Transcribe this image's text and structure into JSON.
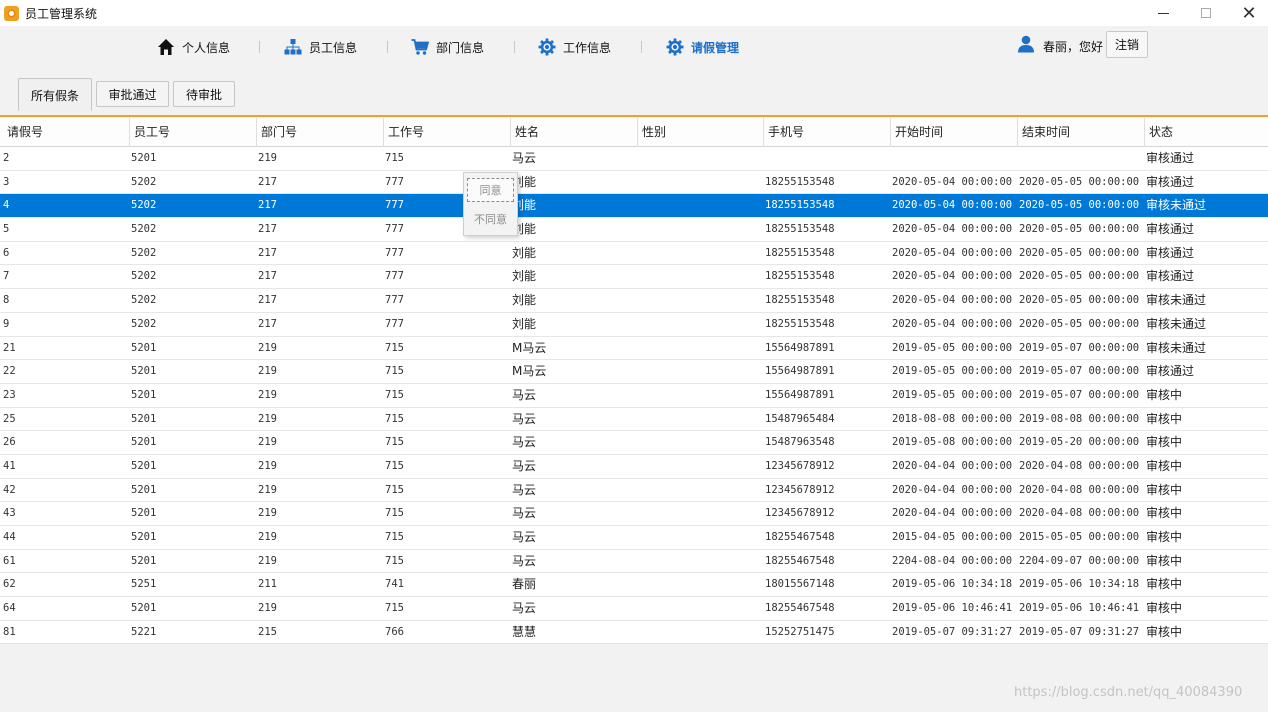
{
  "window": {
    "title": "员工管理系统",
    "minimize": "—",
    "close": "✕"
  },
  "nav": {
    "items": [
      {
        "label": "个人信息",
        "icon": "home-icon"
      },
      {
        "label": "员工信息",
        "icon": "org-tree-icon"
      },
      {
        "label": "部门信息",
        "icon": "cart-icon"
      },
      {
        "label": "工作信息",
        "icon": "gear-icon"
      },
      {
        "label": "请假管理",
        "icon": "gear-icon",
        "active": true
      }
    ],
    "greeting": "春丽，您好",
    "logout_label": "注销"
  },
  "tabs": [
    {
      "label": "所有假条",
      "selected": true
    },
    {
      "label": "审批通过"
    },
    {
      "label": "待审批"
    }
  ],
  "table": {
    "columns": [
      "请假号",
      "员工号",
      "部门号",
      "工作号",
      "姓名",
      "性别",
      "手机号",
      "开始时间",
      "结束时间",
      "状态"
    ],
    "selected_row": 2,
    "rows": [
      [
        "2",
        "5201",
        "219",
        "715",
        "马云",
        "",
        "",
        "",
        "",
        "审核通过"
      ],
      [
        "3",
        "5202",
        "217",
        "777",
        "刘能",
        "",
        "18255153548",
        "2020-05-04 00:00:00",
        "2020-05-05 00:00:00",
        "审核通过"
      ],
      [
        "4",
        "5202",
        "217",
        "777",
        "刘能",
        "",
        "18255153548",
        "2020-05-04 00:00:00",
        "2020-05-05 00:00:00",
        "审核未通过"
      ],
      [
        "5",
        "5202",
        "217",
        "777",
        "刘能",
        "",
        "18255153548",
        "2020-05-04 00:00:00",
        "2020-05-05 00:00:00",
        "审核通过"
      ],
      [
        "6",
        "5202",
        "217",
        "777",
        "刘能",
        "",
        "18255153548",
        "2020-05-04 00:00:00",
        "2020-05-05 00:00:00",
        "审核通过"
      ],
      [
        "7",
        "5202",
        "217",
        "777",
        "刘能",
        "",
        "18255153548",
        "2020-05-04 00:00:00",
        "2020-05-05 00:00:00",
        "审核通过"
      ],
      [
        "8",
        "5202",
        "217",
        "777",
        "刘能",
        "",
        "18255153548",
        "2020-05-04 00:00:00",
        "2020-05-05 00:00:00",
        "审核未通过"
      ],
      [
        "9",
        "5202",
        "217",
        "777",
        "刘能",
        "",
        "18255153548",
        "2020-05-04 00:00:00",
        "2020-05-05 00:00:00",
        "审核未通过"
      ],
      [
        "21",
        "5201",
        "219",
        "715",
        "M马云",
        "",
        "15564987891",
        "2019-05-05 00:00:00",
        "2019-05-07 00:00:00",
        "审核未通过"
      ],
      [
        "22",
        "5201",
        "219",
        "715",
        "M马云",
        "",
        "15564987891",
        "2019-05-05 00:00:00",
        "2019-05-07 00:00:00",
        "审核通过"
      ],
      [
        "23",
        "5201",
        "219",
        "715",
        "马云",
        "",
        "15564987891",
        "2019-05-05 00:00:00",
        "2019-05-07 00:00:00",
        "审核中"
      ],
      [
        "25",
        "5201",
        "219",
        "715",
        "马云",
        "",
        "15487965484",
        "2018-08-08 00:00:00",
        "2019-08-08 00:00:00",
        "审核中"
      ],
      [
        "26",
        "5201",
        "219",
        "715",
        "马云",
        "",
        "15487963548",
        "2019-05-08 00:00:00",
        "2019-05-20 00:00:00",
        "审核中"
      ],
      [
        "41",
        "5201",
        "219",
        "715",
        "马云",
        "",
        "12345678912",
        "2020-04-04 00:00:00",
        "2020-04-08 00:00:00",
        "审核中"
      ],
      [
        "42",
        "5201",
        "219",
        "715",
        "马云",
        "",
        "12345678912",
        "2020-04-04 00:00:00",
        "2020-04-08 00:00:00",
        "审核中"
      ],
      [
        "43",
        "5201",
        "219",
        "715",
        "马云",
        "",
        "12345678912",
        "2020-04-04 00:00:00",
        "2020-04-08 00:00:00",
        "审核中"
      ],
      [
        "44",
        "5201",
        "219",
        "715",
        "马云",
        "",
        "18255467548",
        "2015-04-05 00:00:00",
        "2015-05-05 00:00:00",
        "审核中"
      ],
      [
        "61",
        "5201",
        "219",
        "715",
        "马云",
        "",
        "18255467548",
        "2204-08-04 00:00:00",
        "2204-09-07 00:00:00",
        "审核中"
      ],
      [
        "62",
        "5251",
        "211",
        "741",
        "春丽",
        "",
        "18015567148",
        "2019-05-06 10:34:18",
        "2019-05-06 10:34:18",
        "审核中"
      ],
      [
        "64",
        "5201",
        "219",
        "715",
        "马云",
        "",
        "18255467548",
        "2019-05-06 10:46:41",
        "2019-05-06 10:46:41",
        "审核中"
      ],
      [
        "81",
        "5221",
        "215",
        "766",
        "慧慧",
        "",
        "15252751475",
        "2019-05-07 09:31:27",
        "2019-05-07 09:31:27",
        "审核中"
      ]
    ]
  },
  "context_menu": {
    "agree_label": "同意",
    "disagree_label": "不同意"
  },
  "watermark": "https://blog.csdn.net/qq_40084390",
  "colors": {
    "selection": "#0078d7",
    "accent_orange": "#f0a030",
    "nav_active": "#1e6fc8"
  }
}
